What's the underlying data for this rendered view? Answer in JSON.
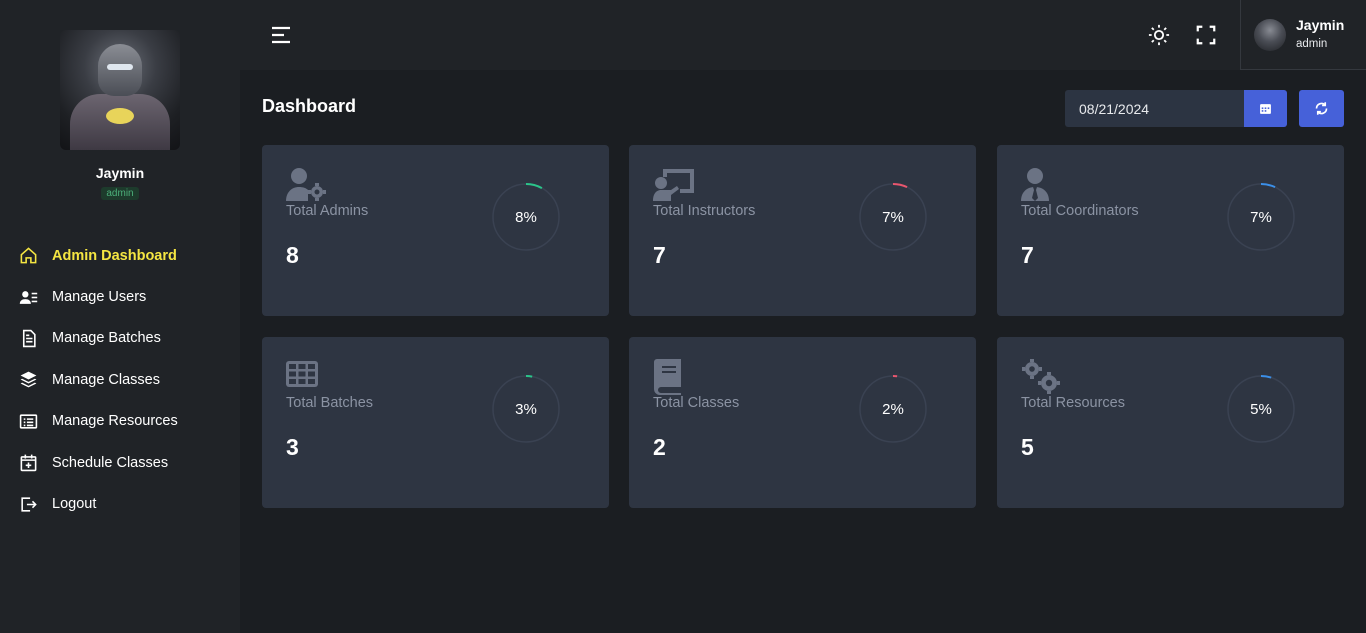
{
  "sidebar": {
    "profile": {
      "name": "Jaymin",
      "role": "admin"
    },
    "items": [
      {
        "label": "Admin Dashboard",
        "icon": "home-icon",
        "active": true
      },
      {
        "label": "Manage Users",
        "icon": "users-list-icon"
      },
      {
        "label": "Manage Batches",
        "icon": "document-icon"
      },
      {
        "label": "Manage Classes",
        "icon": "layers-icon"
      },
      {
        "label": "Manage Resources",
        "icon": "list-icon"
      },
      {
        "label": "Schedule Classes",
        "icon": "calendar-plus-icon"
      },
      {
        "label": "Logout",
        "icon": "logout-icon"
      }
    ]
  },
  "header": {
    "user": {
      "name": "Jaymin",
      "role": "admin"
    }
  },
  "main": {
    "title": "Dashboard",
    "date_value": "08/21/2024"
  },
  "cards": [
    {
      "label": "Total Admins",
      "value": "8",
      "percent": "8%",
      "percent_value": 8,
      "ring_color": "#2bc48a",
      "icon": "user-gear-icon"
    },
    {
      "label": "Total Instructors",
      "value": "7",
      "percent": "7%",
      "percent_value": 7,
      "ring_color": "#e8566e",
      "icon": "chalkboard-teacher-icon"
    },
    {
      "label": "Total Coordinators",
      "value": "7",
      "percent": "7%",
      "percent_value": 7,
      "ring_color": "#3b8fe8",
      "icon": "user-tie-icon"
    },
    {
      "label": "Total Batches",
      "value": "3",
      "percent": "3%",
      "percent_value": 3,
      "ring_color": "#2bc48a",
      "icon": "grid-icon"
    },
    {
      "label": "Total Classes",
      "value": "2",
      "percent": "2%",
      "percent_value": 2,
      "ring_color": "#e8566e",
      "icon": "book-icon"
    },
    {
      "label": "Total Resources",
      "value": "5",
      "percent": "5%",
      "percent_value": 5,
      "ring_color": "#3b8fe8",
      "icon": "gears-icon"
    }
  ],
  "colors": {
    "accent": "#4661d9",
    "active_nav": "#f5e642",
    "card_bg": "#2e3542"
  }
}
